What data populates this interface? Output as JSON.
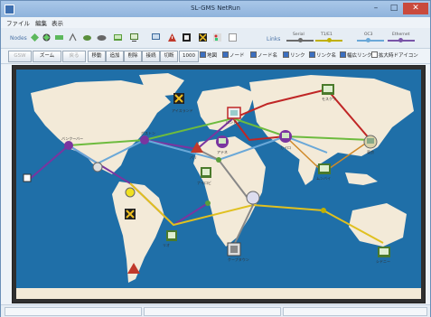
{
  "window": {
    "title": "SL-GMS NetRun",
    "minimize_glyph": "–",
    "maximize_glyph": "□",
    "close_glyph": "✕"
  },
  "menu": [
    "ファイル",
    "編集",
    "表示"
  ],
  "toolbar": {
    "nodes_label": "Nodes",
    "links_label": "Links",
    "node_icons": [
      "green-diamond-node-icon",
      "router-node-icon",
      "switch-node-icon",
      "antenna-node-icon",
      "cloud-node-icon",
      "workstation-node-icon",
      "server-node-icon",
      "monitor-node-icon",
      "warning-node-icon",
      "box-node-icon",
      "cross-node-icon",
      "person-node-icon",
      "blank-node-icon"
    ],
    "link_types": [
      {
        "label": "Serial",
        "color": "#6a6a6a"
      },
      {
        "label": "T1/E1",
        "color": "#c0b000"
      },
      {
        "label": "OC3",
        "color": "#6aa8d8"
      },
      {
        "label": "Ethernet",
        "color": "#7a55a8"
      }
    ]
  },
  "buttons": [
    {
      "label": "GSW",
      "enabled": false
    },
    {
      "label": "ズーム",
      "enabled": true
    },
    {
      "label": "戻る",
      "enabled": false
    },
    {
      "label": "移動",
      "enabled": true
    },
    {
      "label": "追加",
      "enabled": true
    },
    {
      "label": "削除",
      "enabled": true
    },
    {
      "label": "接続",
      "enabled": true
    },
    {
      "label": "切断",
      "enabled": true
    },
    {
      "label": "1000",
      "enabled": true
    }
  ],
  "checkboxes": [
    {
      "label": "地図",
      "checked": true
    },
    {
      "label": "ノード",
      "checked": true
    },
    {
      "label": "ノード名",
      "checked": true
    },
    {
      "label": "リンク",
      "checked": true
    },
    {
      "label": "リンク名",
      "checked": true
    },
    {
      "label": "幅広リンク",
      "checked": true
    },
    {
      "label": "拡大時ドアイコン",
      "checked": false
    }
  ],
  "map": {
    "ocean_color": "#1f6fa8",
    "land_color": "#f3ead8",
    "node_labels": [
      "アイスランド",
      "ロンドン",
      "モスクワ",
      "パリ",
      "アテネ",
      "カイロ",
      "ナイロビ",
      "東京",
      "シドニー",
      "ムンバイ",
      "ケープタウン",
      "リオ",
      "ボストン",
      "バンクーバー"
    ]
  },
  "colors": {
    "accent": "#3b6fc0",
    "close": "#c94a3d",
    "link_red": "#c02626",
    "link_green": "#6dbb3e",
    "link_purple": "#7a35a0",
    "link_blue": "#6aa8d8",
    "link_yellow": "#e0c020"
  }
}
